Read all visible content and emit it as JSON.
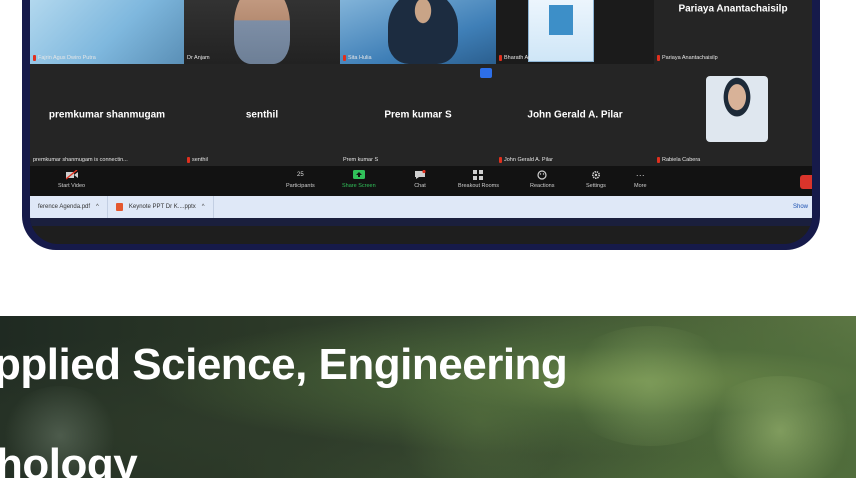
{
  "meeting": {
    "tiles_row1": [
      {
        "caption": "Fajrin Agus Dwiro Putra"
      },
      {
        "caption": "Dr Anjam"
      },
      {
        "caption": "Sita Hulia"
      },
      {
        "caption": "Bharath Ar"
      },
      {
        "name": "Pariaya Anantachaisilp",
        "caption": "Pariaya Anantachaisilp"
      }
    ],
    "tiles_row2": [
      {
        "name": "premkumar shanmugam",
        "caption": "premkumar shanmugam is connectin..."
      },
      {
        "name": "senthil",
        "caption": "senthil"
      },
      {
        "name": "Prem kumar S",
        "caption": "Prem kumar S"
      },
      {
        "name": "John Gerald A. Pilar",
        "caption": "John Gerald A. Pilar"
      },
      {
        "caption": "Rabiela Cabera"
      }
    ]
  },
  "toolbar": {
    "start_video": "Start Video",
    "participants": "Participants",
    "participants_count": "25",
    "share_screen": "Share Screen",
    "chat": "Chat",
    "breakout_rooms": "Breakout Rooms",
    "reactions": "Reactions",
    "settings": "Settings",
    "more": "More"
  },
  "downloads": {
    "item1": "ference Agenda.pdf",
    "item2": "Keynote PPT Dr K....pptx",
    "show_all": "Show"
  },
  "hero": {
    "line1": "pplied Science, Engineering",
    "line2": "hology"
  },
  "colors": {
    "frame": "#161a4a",
    "green_accent": "#31c15a",
    "end_red": "#d9342b"
  }
}
